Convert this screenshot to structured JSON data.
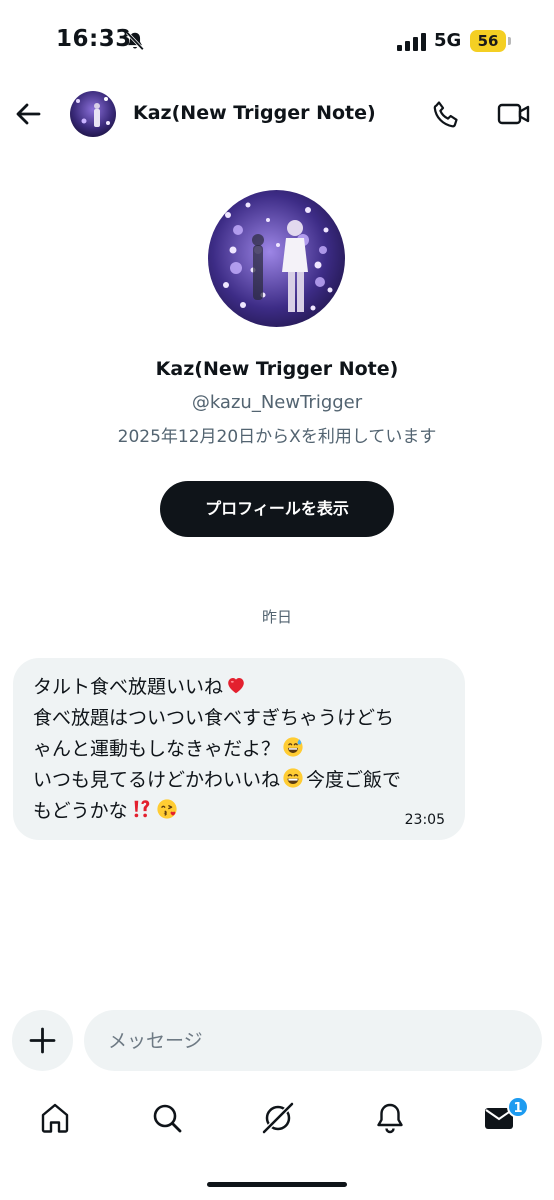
{
  "status_bar": {
    "time": "16:33",
    "network": "5G",
    "battery": "56"
  },
  "header": {
    "name": "Kaz(New Trigger Note)"
  },
  "profile": {
    "name": "Kaz(New Trigger Note)",
    "handle": "@kazu_NewTrigger",
    "joined": "2025年12月20日からXを利用しています",
    "view_profile_label": "プロフィールを表示"
  },
  "conversation": {
    "date_separator": "昨日",
    "message": {
      "line1": "タルト食べ放題いいね",
      "line2": "食べ放題はついつい食べすぎちゃうけどち",
      "line3": "ゃんと運動もしなきゃだよ？",
      "line4a": "いつも見てるけどかわいいね",
      "line4b": "今度ご飯で",
      "line5": "もどうかな",
      "time": "23:05",
      "emojis": [
        "red-heart",
        "grinning-sweat",
        "beaming-grin",
        "exclamation-question",
        "face-blowing-kiss"
      ]
    }
  },
  "composer": {
    "placeholder": "メッセージ"
  },
  "bottom_nav": {
    "items": [
      "home-icon",
      "search-icon",
      "grok-icon",
      "notifications-icon",
      "messages-icon"
    ],
    "messages_badge": "1"
  },
  "colors": {
    "accent": "#1d9bf0",
    "text_primary": "#0f1419",
    "text_secondary": "#536471",
    "bubble_bg": "#eff3f4",
    "battery": "#f4cf23"
  }
}
